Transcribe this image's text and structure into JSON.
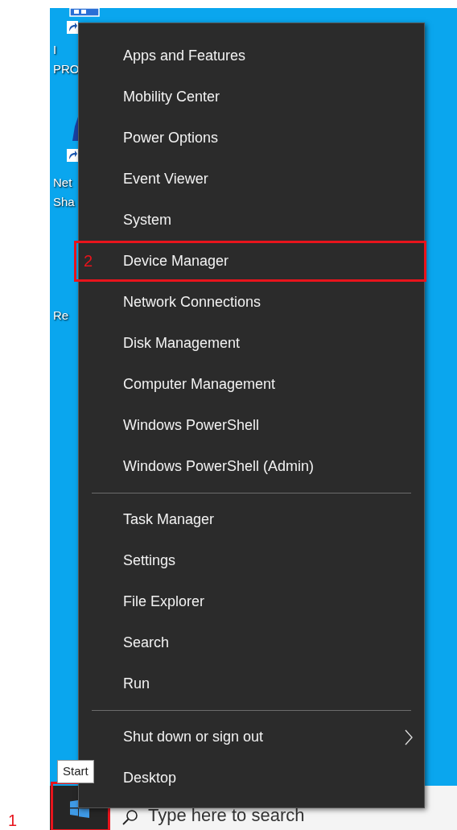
{
  "desktop_icons": [
    {
      "lines": [
        "I",
        "PRO"
      ]
    },
    {
      "lines": [
        "Net",
        "Sha"
      ]
    },
    {
      "lines": [
        "Re"
      ]
    }
  ],
  "menu": {
    "groups": [
      [
        {
          "label": "Apps and Features"
        },
        {
          "label": "Mobility Center"
        },
        {
          "label": "Power Options"
        },
        {
          "label": "Event Viewer"
        },
        {
          "label": "System"
        },
        {
          "label": "Device Manager",
          "annotation": "2"
        },
        {
          "label": "Network Connections"
        },
        {
          "label": "Disk Management"
        },
        {
          "label": "Computer Management"
        },
        {
          "label": "Windows PowerShell"
        },
        {
          "label": "Windows PowerShell (Admin)"
        }
      ],
      [
        {
          "label": "Task Manager"
        },
        {
          "label": "Settings"
        },
        {
          "label": "File Explorer"
        },
        {
          "label": "Search"
        },
        {
          "label": "Run"
        }
      ],
      [
        {
          "label": "Shut down or sign out",
          "has_submenu": true
        },
        {
          "label": "Desktop"
        }
      ]
    ]
  },
  "taskbar": {
    "start": {
      "tooltip": "Start",
      "annotation": "1"
    },
    "search": {
      "placeholder": "Type here to search"
    }
  }
}
